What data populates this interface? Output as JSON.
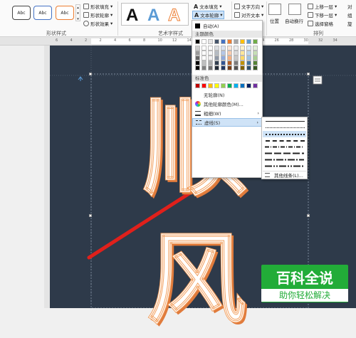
{
  "ribbon": {
    "shape_styles": [
      "Abc",
      "Abc",
      "Abc"
    ],
    "shape_fill_label": "形状填充",
    "shape_outline_label": "形状轮廓",
    "shape_effects_label": "形状效果",
    "group_shape_styles": "形状样式",
    "art_letters": [
      "A",
      "A",
      "A"
    ],
    "group_art_styles": "艺术字样式",
    "text_fill_label": "文本填充",
    "text_outline_label": "文本轮廓",
    "text_direction_label": "文字方向",
    "align_text_label": "对齐文本",
    "position_label": "位置",
    "wrap_label": "自动换行",
    "bring_forward_label": "上移一层",
    "send_backward_label": "下移一层",
    "selection_pane_label": "选择窗格",
    "group_arrange": "排列",
    "extra_1": "对",
    "extra_2": "组",
    "extra_3": "旋"
  },
  "ruler": {
    "marks": [
      "6",
      "4",
      "2",
      "2",
      "4",
      "6",
      "8",
      "10",
      "12",
      "14",
      "16",
      "18",
      "20",
      "22",
      "24",
      "26",
      "28",
      "30",
      "32",
      "34"
    ]
  },
  "document": {
    "char_1": "顺",
    "char_2": "风"
  },
  "dropdown": {
    "auto_label": "自动(A)",
    "theme_colors_header": "主题颜色",
    "standard_colors_header": "标准色",
    "no_outline_label": "无轮廓(N)",
    "more_colors_label": "其他轮廓颜色(M)...",
    "weight_label": "粗细(W)",
    "dashes_label": "虚线(S)",
    "theme_colors": [
      "#000000",
      "#ffffff",
      "#e7e6e6",
      "#44546a",
      "#4472c4",
      "#ed7d31",
      "#a5a5a5",
      "#ffc000",
      "#5b9bd5",
      "#70ad47"
    ],
    "standard_colors": [
      "#c00000",
      "#ff0000",
      "#ffc000",
      "#ffff00",
      "#92d050",
      "#00b050",
      "#00b0f0",
      "#0070c0",
      "#002060",
      "#7030a0"
    ]
  },
  "submenu": {
    "more_lines_label": "其他线条(L)..."
  },
  "watermark": {
    "top": "百科全说",
    "bottom": "助你轻松解决"
  }
}
